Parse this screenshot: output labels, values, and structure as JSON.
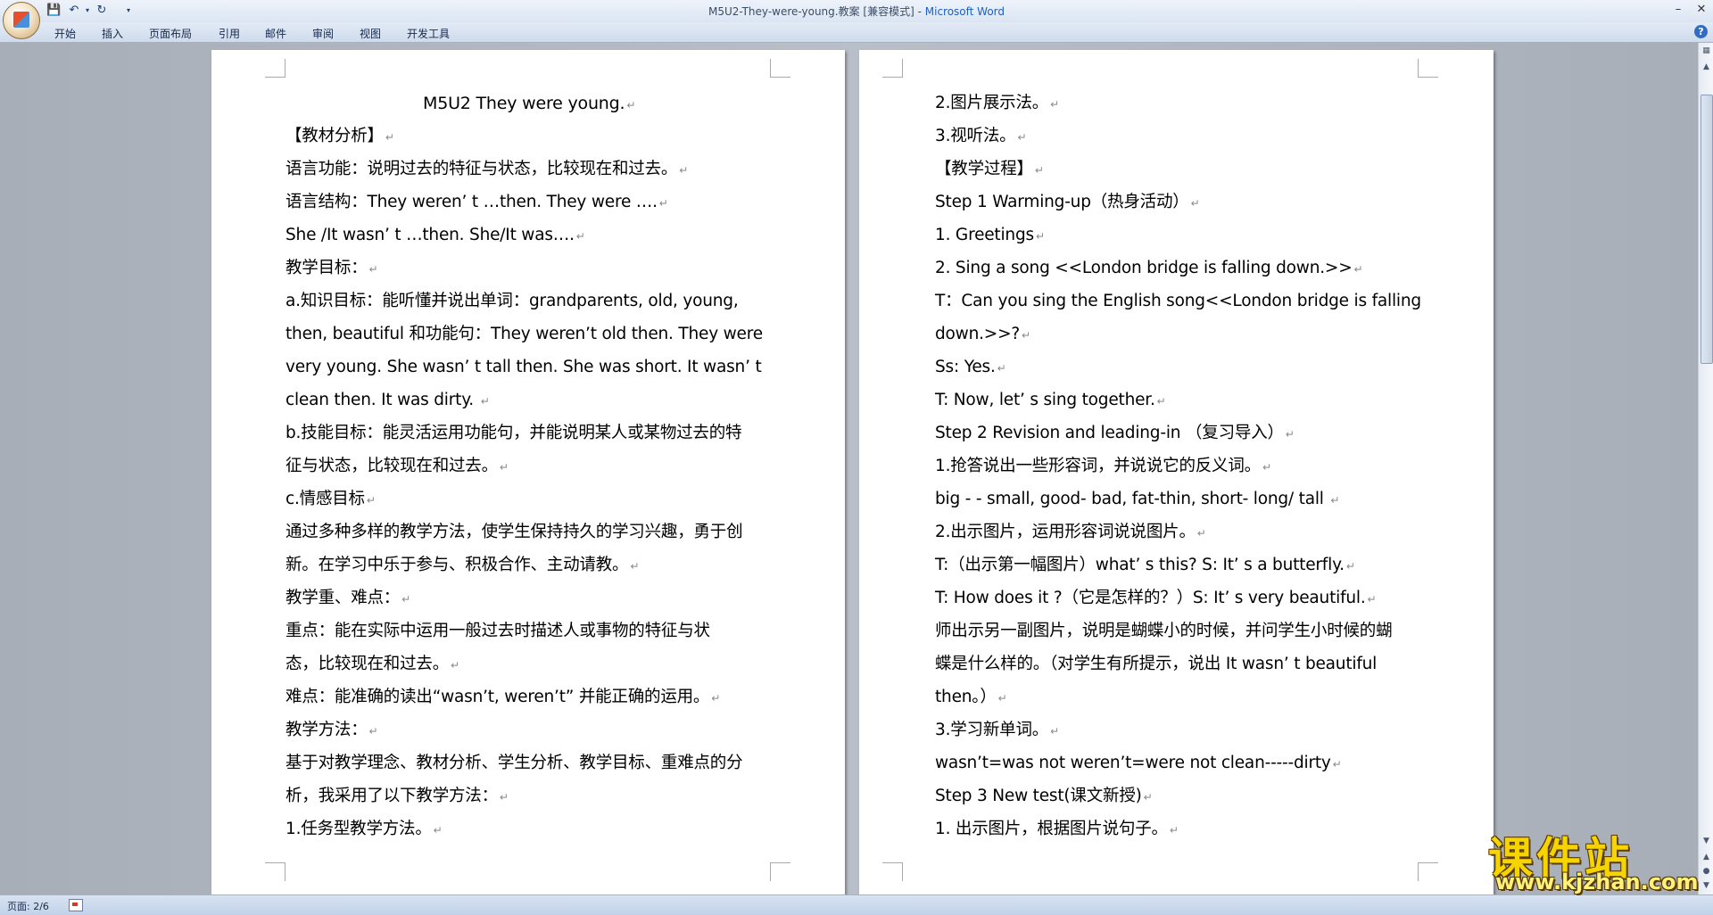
{
  "window": {
    "title_doc": "M5U2-They-were-young.教案 [兼容模式] - ",
    "title_app": "Microsoft Word"
  },
  "ribbon": {
    "tabs": [
      "开始",
      "插入",
      "页面布局",
      "引用",
      "邮件",
      "审阅",
      "视图",
      "开发工具"
    ]
  },
  "status": {
    "page": "页面: 2/6"
  },
  "watermark": {
    "site_cn": "课件站",
    "site_url": "www.kjzhan.com"
  },
  "pages": {
    "left": [
      "M5U2  They  were  young.",
      "【教材分析】",
      "语言功能：说明过去的特征与状态，比较现在和过去。",
      "语言结构：They  weren’ t  …then.           They  were  ….",
      "               She  /It  wasn’ t  …then.       She/It  was….",
      "教学目标：",
      "a.知识目标：能听懂并说出单词：grandparents,  old,  young,",
      "then, beautiful  和功能句：They weren’t old then. They were",
      "very young. She wasn’ t tall then. She was short. It wasn’ t",
      "clean then. It was dirty. ",
      "b.技能目标：能灵活运用功能句，并能说明某人或某物过去的特",
      "征与状态，比较现在和过去。",
      "c.情感目标",
      "通过多种多样的教学方法，使学生保持持久的学习兴趣，勇于创",
      "新。在学习中乐于参与、积极合作、主动请教。",
      "教学重、难点：",
      "      重点：能在实际中运用一般过去时描述人或事物的特征与状",
      "   态，比较现在和过去。",
      "       难点：能准确的读出“wasn’t,  weren’t” 并能正确的运用。",
      "教学方法：",
      "基于对教学理念、教材分析、学生分析、教学目标、重难点的分",
      "析，我采用了以下教学方法：",
      "1.任务型教学方法。"
    ],
    "right": [
      "2.图片展示法。",
      "3.视听法。",
      "【教学过程】",
      "Step 1 Warming-up（热身活动）",
      "1. Greetings",
      "2. Sing  a  song  <<London  bridge  is  falling  down.>>",
      "T：Can you sing the English song<<London bridge is falling",
      "down.>>?",
      "Ss: Yes.",
      "T: Now, let’ s sing together.",
      "Step 2 Revision and leading-in  （复习导入）",
      "1.抢答说出一些形容词，并说说它的反义词。",
      "  big  - - small,  good-  bad,  fat-thin,    short-  long/  tall   ",
      "2.出示图片，运用形容词说说图片。",
      "T:（出示第一幅图片）what’ s  this?  S:  It’ s  a  butterfly.",
      "T:  How  does  it ?（它是怎样的？）S:  It’ s  very  beautiful.",
      "师出示另一副图片，说明是蝴蝶小的时候，并问学生小时候的蝴",
      "蝶是什么样的。（对学生有所提示，说出 It  wasn’ t  beautiful",
      "then。）",
      "3.学习新单词。",
      "wasn’t=was not     weren’t=were not     clean-----dirty",
      "Step 3 New test(课文新授)",
      "1. 出示图片，根据图片说句子。"
    ]
  }
}
